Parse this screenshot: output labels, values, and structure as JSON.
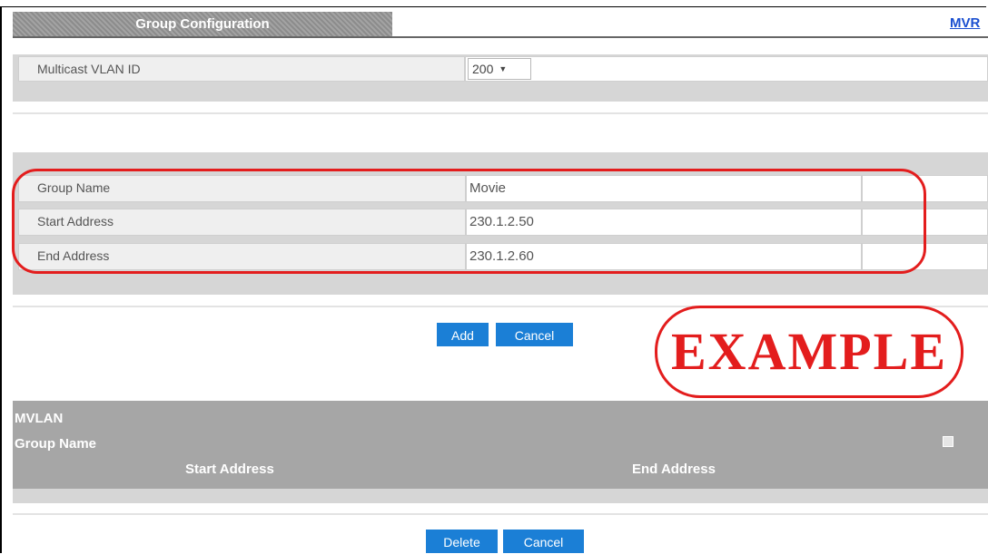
{
  "header": {
    "tab_title": "Group Configuration",
    "mvr_link": "MVR"
  },
  "vlan": {
    "label": "Multicast VLAN ID",
    "selected": "200"
  },
  "group_form": {
    "rows": [
      {
        "label": "Group Name",
        "value": "Movie"
      },
      {
        "label": "Start Address",
        "value": "230.1.2.50"
      },
      {
        "label": "End Address",
        "value": "230.1.2.60"
      }
    ],
    "add_label": "Add",
    "cancel_label": "Cancel"
  },
  "watermark": "EXAMPLE",
  "table": {
    "header_mvlan": "MVLAN",
    "header_group_name": "Group Name",
    "header_start": "Start Address",
    "header_end": "End Address"
  },
  "footer": {
    "delete_label": "Delete",
    "cancel_label": "Cancel"
  },
  "colors": {
    "accent_button": "#1b7fd6",
    "highlight_red": "#e31d1d",
    "link_blue": "#1a4fd0"
  }
}
